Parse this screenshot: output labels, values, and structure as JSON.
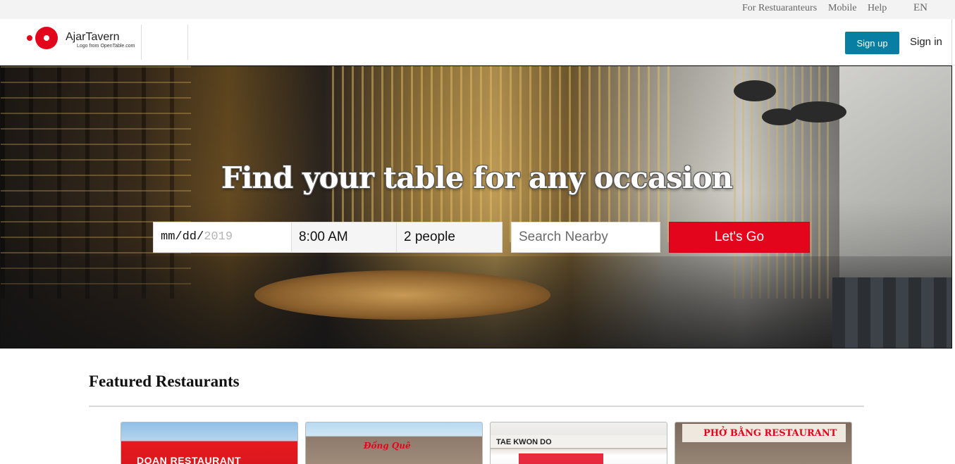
{
  "utility_bar": {
    "links": [
      "For Restuaranteurs",
      "Mobile",
      "Help"
    ],
    "language": "EN"
  },
  "header": {
    "brand_name": "AjarTavern",
    "brand_credit": "Logo from OpenTable.com",
    "signup_label": "Sign up",
    "signin_label": "Sign in"
  },
  "hero": {
    "title": "Find your table for any occasion",
    "date_format": "mm/dd/",
    "date_year": "2019",
    "time_value": "8:00 AM",
    "party_size_value": "2 people",
    "location_placeholder": "Search Nearby",
    "submit_label": "Let's Go"
  },
  "featured": {
    "title": "Featured Restaurants",
    "cards": [
      {
        "sign_text": "DOAN RESTAURANT"
      },
      {
        "sign_text": "Đồng Quê"
      },
      {
        "sign_text": "TAE KWON DO"
      },
      {
        "sign_text": "PHỞ BẰNG RESTAURANT"
      }
    ]
  },
  "colors": {
    "brand_red": "#e3051c",
    "signup_blue": "#097ea3",
    "utility_bg": "#f3f3f3"
  }
}
